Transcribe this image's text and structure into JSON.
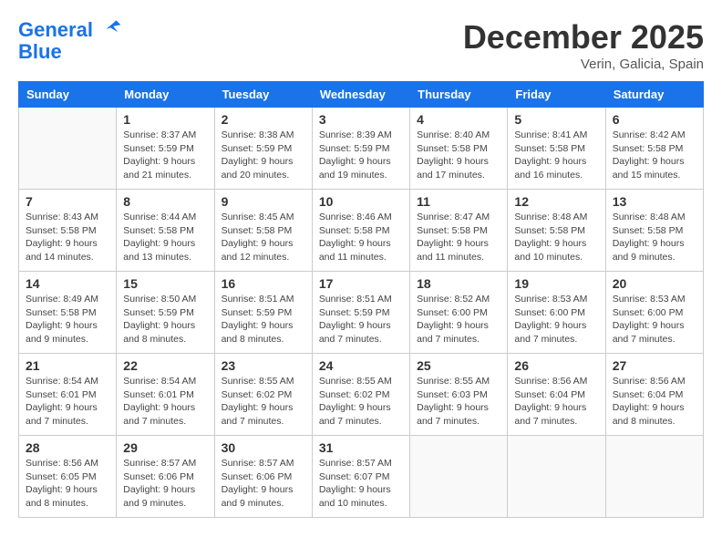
{
  "header": {
    "logo_line1": "General",
    "logo_line2": "Blue",
    "month": "December 2025",
    "location": "Verin, Galicia, Spain"
  },
  "weekdays": [
    "Sunday",
    "Monday",
    "Tuesday",
    "Wednesday",
    "Thursday",
    "Friday",
    "Saturday"
  ],
  "weeks": [
    [
      {
        "day": "",
        "sunrise": "",
        "sunset": "",
        "daylight": ""
      },
      {
        "day": "1",
        "sunrise": "Sunrise: 8:37 AM",
        "sunset": "Sunset: 5:59 PM",
        "daylight": "Daylight: 9 hours and 21 minutes."
      },
      {
        "day": "2",
        "sunrise": "Sunrise: 8:38 AM",
        "sunset": "Sunset: 5:59 PM",
        "daylight": "Daylight: 9 hours and 20 minutes."
      },
      {
        "day": "3",
        "sunrise": "Sunrise: 8:39 AM",
        "sunset": "Sunset: 5:59 PM",
        "daylight": "Daylight: 9 hours and 19 minutes."
      },
      {
        "day": "4",
        "sunrise": "Sunrise: 8:40 AM",
        "sunset": "Sunset: 5:58 PM",
        "daylight": "Daylight: 9 hours and 17 minutes."
      },
      {
        "day": "5",
        "sunrise": "Sunrise: 8:41 AM",
        "sunset": "Sunset: 5:58 PM",
        "daylight": "Daylight: 9 hours and 16 minutes."
      },
      {
        "day": "6",
        "sunrise": "Sunrise: 8:42 AM",
        "sunset": "Sunset: 5:58 PM",
        "daylight": "Daylight: 9 hours and 15 minutes."
      }
    ],
    [
      {
        "day": "7",
        "sunrise": "Sunrise: 8:43 AM",
        "sunset": "Sunset: 5:58 PM",
        "daylight": "Daylight: 9 hours and 14 minutes."
      },
      {
        "day": "8",
        "sunrise": "Sunrise: 8:44 AM",
        "sunset": "Sunset: 5:58 PM",
        "daylight": "Daylight: 9 hours and 13 minutes."
      },
      {
        "day": "9",
        "sunrise": "Sunrise: 8:45 AM",
        "sunset": "Sunset: 5:58 PM",
        "daylight": "Daylight: 9 hours and 12 minutes."
      },
      {
        "day": "10",
        "sunrise": "Sunrise: 8:46 AM",
        "sunset": "Sunset: 5:58 PM",
        "daylight": "Daylight: 9 hours and 11 minutes."
      },
      {
        "day": "11",
        "sunrise": "Sunrise: 8:47 AM",
        "sunset": "Sunset: 5:58 PM",
        "daylight": "Daylight: 9 hours and 11 minutes."
      },
      {
        "day": "12",
        "sunrise": "Sunrise: 8:48 AM",
        "sunset": "Sunset: 5:58 PM",
        "daylight": "Daylight: 9 hours and 10 minutes."
      },
      {
        "day": "13",
        "sunrise": "Sunrise: 8:48 AM",
        "sunset": "Sunset: 5:58 PM",
        "daylight": "Daylight: 9 hours and 9 minutes."
      }
    ],
    [
      {
        "day": "14",
        "sunrise": "Sunrise: 8:49 AM",
        "sunset": "Sunset: 5:58 PM",
        "daylight": "Daylight: 9 hours and 9 minutes."
      },
      {
        "day": "15",
        "sunrise": "Sunrise: 8:50 AM",
        "sunset": "Sunset: 5:59 PM",
        "daylight": "Daylight: 9 hours and 8 minutes."
      },
      {
        "day": "16",
        "sunrise": "Sunrise: 8:51 AM",
        "sunset": "Sunset: 5:59 PM",
        "daylight": "Daylight: 9 hours and 8 minutes."
      },
      {
        "day": "17",
        "sunrise": "Sunrise: 8:51 AM",
        "sunset": "Sunset: 5:59 PM",
        "daylight": "Daylight: 9 hours and 7 minutes."
      },
      {
        "day": "18",
        "sunrise": "Sunrise: 8:52 AM",
        "sunset": "Sunset: 6:00 PM",
        "daylight": "Daylight: 9 hours and 7 minutes."
      },
      {
        "day": "19",
        "sunrise": "Sunrise: 8:53 AM",
        "sunset": "Sunset: 6:00 PM",
        "daylight": "Daylight: 9 hours and 7 minutes."
      },
      {
        "day": "20",
        "sunrise": "Sunrise: 8:53 AM",
        "sunset": "Sunset: 6:00 PM",
        "daylight": "Daylight: 9 hours and 7 minutes."
      }
    ],
    [
      {
        "day": "21",
        "sunrise": "Sunrise: 8:54 AM",
        "sunset": "Sunset: 6:01 PM",
        "daylight": "Daylight: 9 hours and 7 minutes."
      },
      {
        "day": "22",
        "sunrise": "Sunrise: 8:54 AM",
        "sunset": "Sunset: 6:01 PM",
        "daylight": "Daylight: 9 hours and 7 minutes."
      },
      {
        "day": "23",
        "sunrise": "Sunrise: 8:55 AM",
        "sunset": "Sunset: 6:02 PM",
        "daylight": "Daylight: 9 hours and 7 minutes."
      },
      {
        "day": "24",
        "sunrise": "Sunrise: 8:55 AM",
        "sunset": "Sunset: 6:02 PM",
        "daylight": "Daylight: 9 hours and 7 minutes."
      },
      {
        "day": "25",
        "sunrise": "Sunrise: 8:55 AM",
        "sunset": "Sunset: 6:03 PM",
        "daylight": "Daylight: 9 hours and 7 minutes."
      },
      {
        "day": "26",
        "sunrise": "Sunrise: 8:56 AM",
        "sunset": "Sunset: 6:04 PM",
        "daylight": "Daylight: 9 hours and 7 minutes."
      },
      {
        "day": "27",
        "sunrise": "Sunrise: 8:56 AM",
        "sunset": "Sunset: 6:04 PM",
        "daylight": "Daylight: 9 hours and 8 minutes."
      }
    ],
    [
      {
        "day": "28",
        "sunrise": "Sunrise: 8:56 AM",
        "sunset": "Sunset: 6:05 PM",
        "daylight": "Daylight: 9 hours and 8 minutes."
      },
      {
        "day": "29",
        "sunrise": "Sunrise: 8:57 AM",
        "sunset": "Sunset: 6:06 PM",
        "daylight": "Daylight: 9 hours and 9 minutes."
      },
      {
        "day": "30",
        "sunrise": "Sunrise: 8:57 AM",
        "sunset": "Sunset: 6:06 PM",
        "daylight": "Daylight: 9 hours and 9 minutes."
      },
      {
        "day": "31",
        "sunrise": "Sunrise: 8:57 AM",
        "sunset": "Sunset: 6:07 PM",
        "daylight": "Daylight: 9 hours and 10 minutes."
      },
      {
        "day": "",
        "sunrise": "",
        "sunset": "",
        "daylight": ""
      },
      {
        "day": "",
        "sunrise": "",
        "sunset": "",
        "daylight": ""
      },
      {
        "day": "",
        "sunrise": "",
        "sunset": "",
        "daylight": ""
      }
    ]
  ]
}
